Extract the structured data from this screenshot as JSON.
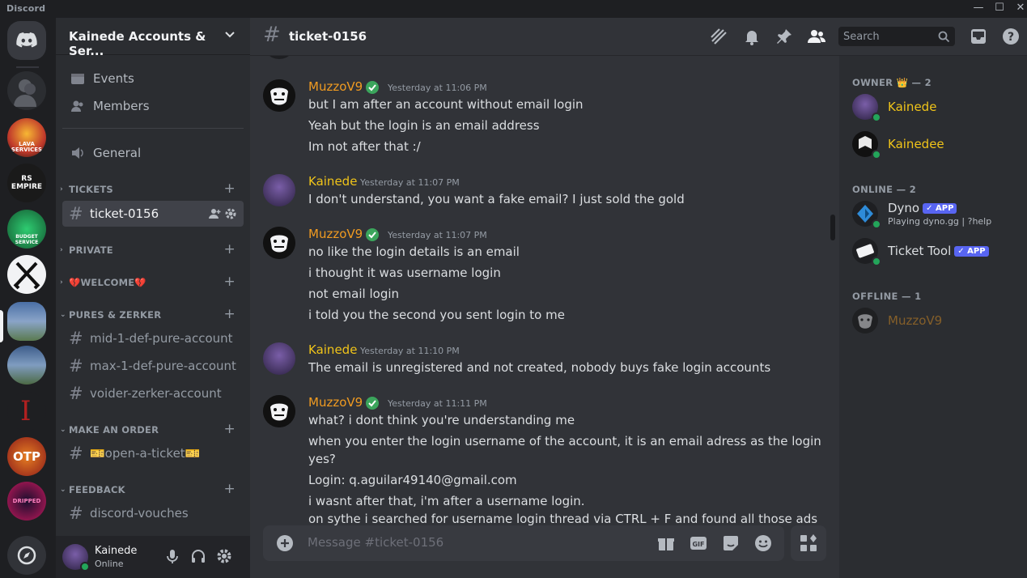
{
  "app": {
    "title": "Discord"
  },
  "guild": {
    "name": "Kainede Accounts & Ser..."
  },
  "sidebar": {
    "nav": [
      {
        "label": "Events"
      },
      {
        "label": "Members"
      },
      {
        "label": "General"
      }
    ],
    "categories": [
      {
        "name": "TICKETS"
      },
      {
        "name": "PRIVATE"
      },
      {
        "name": "💔WELCOME💔"
      },
      {
        "name": "PURES & ZERKER"
      },
      {
        "name": "MAKE AN ORDER"
      },
      {
        "name": "FEEDBACK"
      }
    ],
    "channels": [
      {
        "name": "ticket-0156"
      },
      {
        "name": "mid-1-def-pure-account"
      },
      {
        "name": "max-1-def-pure-account"
      },
      {
        "name": "voider-zerker-account"
      },
      {
        "name": "🎫open-a-ticket🎫"
      },
      {
        "name": "discord-vouches"
      }
    ],
    "servers": [
      {
        "label": "LAVA SERVICES"
      },
      {
        "label": "RS EMPIRE"
      },
      {
        "label": "BUDGET SERVICE"
      },
      {
        "label": "OTP"
      },
      {
        "label": "DRIPPED"
      }
    ]
  },
  "user": {
    "name": "Kainede",
    "status": "Online"
  },
  "channel": {
    "name": "ticket-0156"
  },
  "header": {
    "search_placeholder": "Search"
  },
  "messages": [
    {
      "author": "MuzzoV9",
      "timestamp": "Yesterday at 11:06 PM",
      "lines": [
        "but I am after an account without email login",
        "Yeah but the login is an email address",
        "Im not after that :/"
      ]
    },
    {
      "author": "Kainede",
      "timestamp": "Yesterday at 11:07 PM",
      "lines": [
        "I don't understand, you want a fake email? I just sold the gold"
      ]
    },
    {
      "author": "MuzzoV9",
      "timestamp": "Yesterday at 11:07 PM",
      "lines": [
        "no like the login details is an email",
        "i thought it was username login",
        "not email login",
        "i told you the second you sent login to me"
      ]
    },
    {
      "author": "Kainede",
      "timestamp": "Yesterday at 11:10 PM",
      "lines": [
        "The email is unregistered and not created, nobody buys fake login accounts"
      ]
    },
    {
      "author": "MuzzoV9",
      "timestamp": "Yesterday at 11:11 PM",
      "lines": [
        "what? i dont think you're understanding me",
        "when you enter the login username of the account, it is an email adress as the login",
        "yes?",
        "Login: q.aguilar49140@gmail.com",
        "i wasnt after that, i'm after a username login.",
        "on sythe i searched for username login thread via CTRL + F and found all those ads"
      ]
    }
  ],
  "composer": {
    "placeholder": "Message #ticket-0156"
  },
  "members": {
    "groups": [
      {
        "title": "OWNER 👑 — 2"
      },
      {
        "title": "ONLINE — 2"
      },
      {
        "title": "OFFLINE — 1"
      }
    ],
    "list": [
      {
        "name": "Kainede"
      },
      {
        "name": "Kainedee"
      },
      {
        "name": "Dyno",
        "badge": "APP",
        "activity": "Playing dyno.gg | ?help"
      },
      {
        "name": "Ticket Tool",
        "badge": "APP"
      },
      {
        "name": "MuzzoV9"
      }
    ]
  },
  "colors": {
    "owner": "#f0c419",
    "muzzo": "#f09b21",
    "kainede_author": "#f0c419",
    "online": "#23a55a",
    "brand": "#5865f2"
  }
}
